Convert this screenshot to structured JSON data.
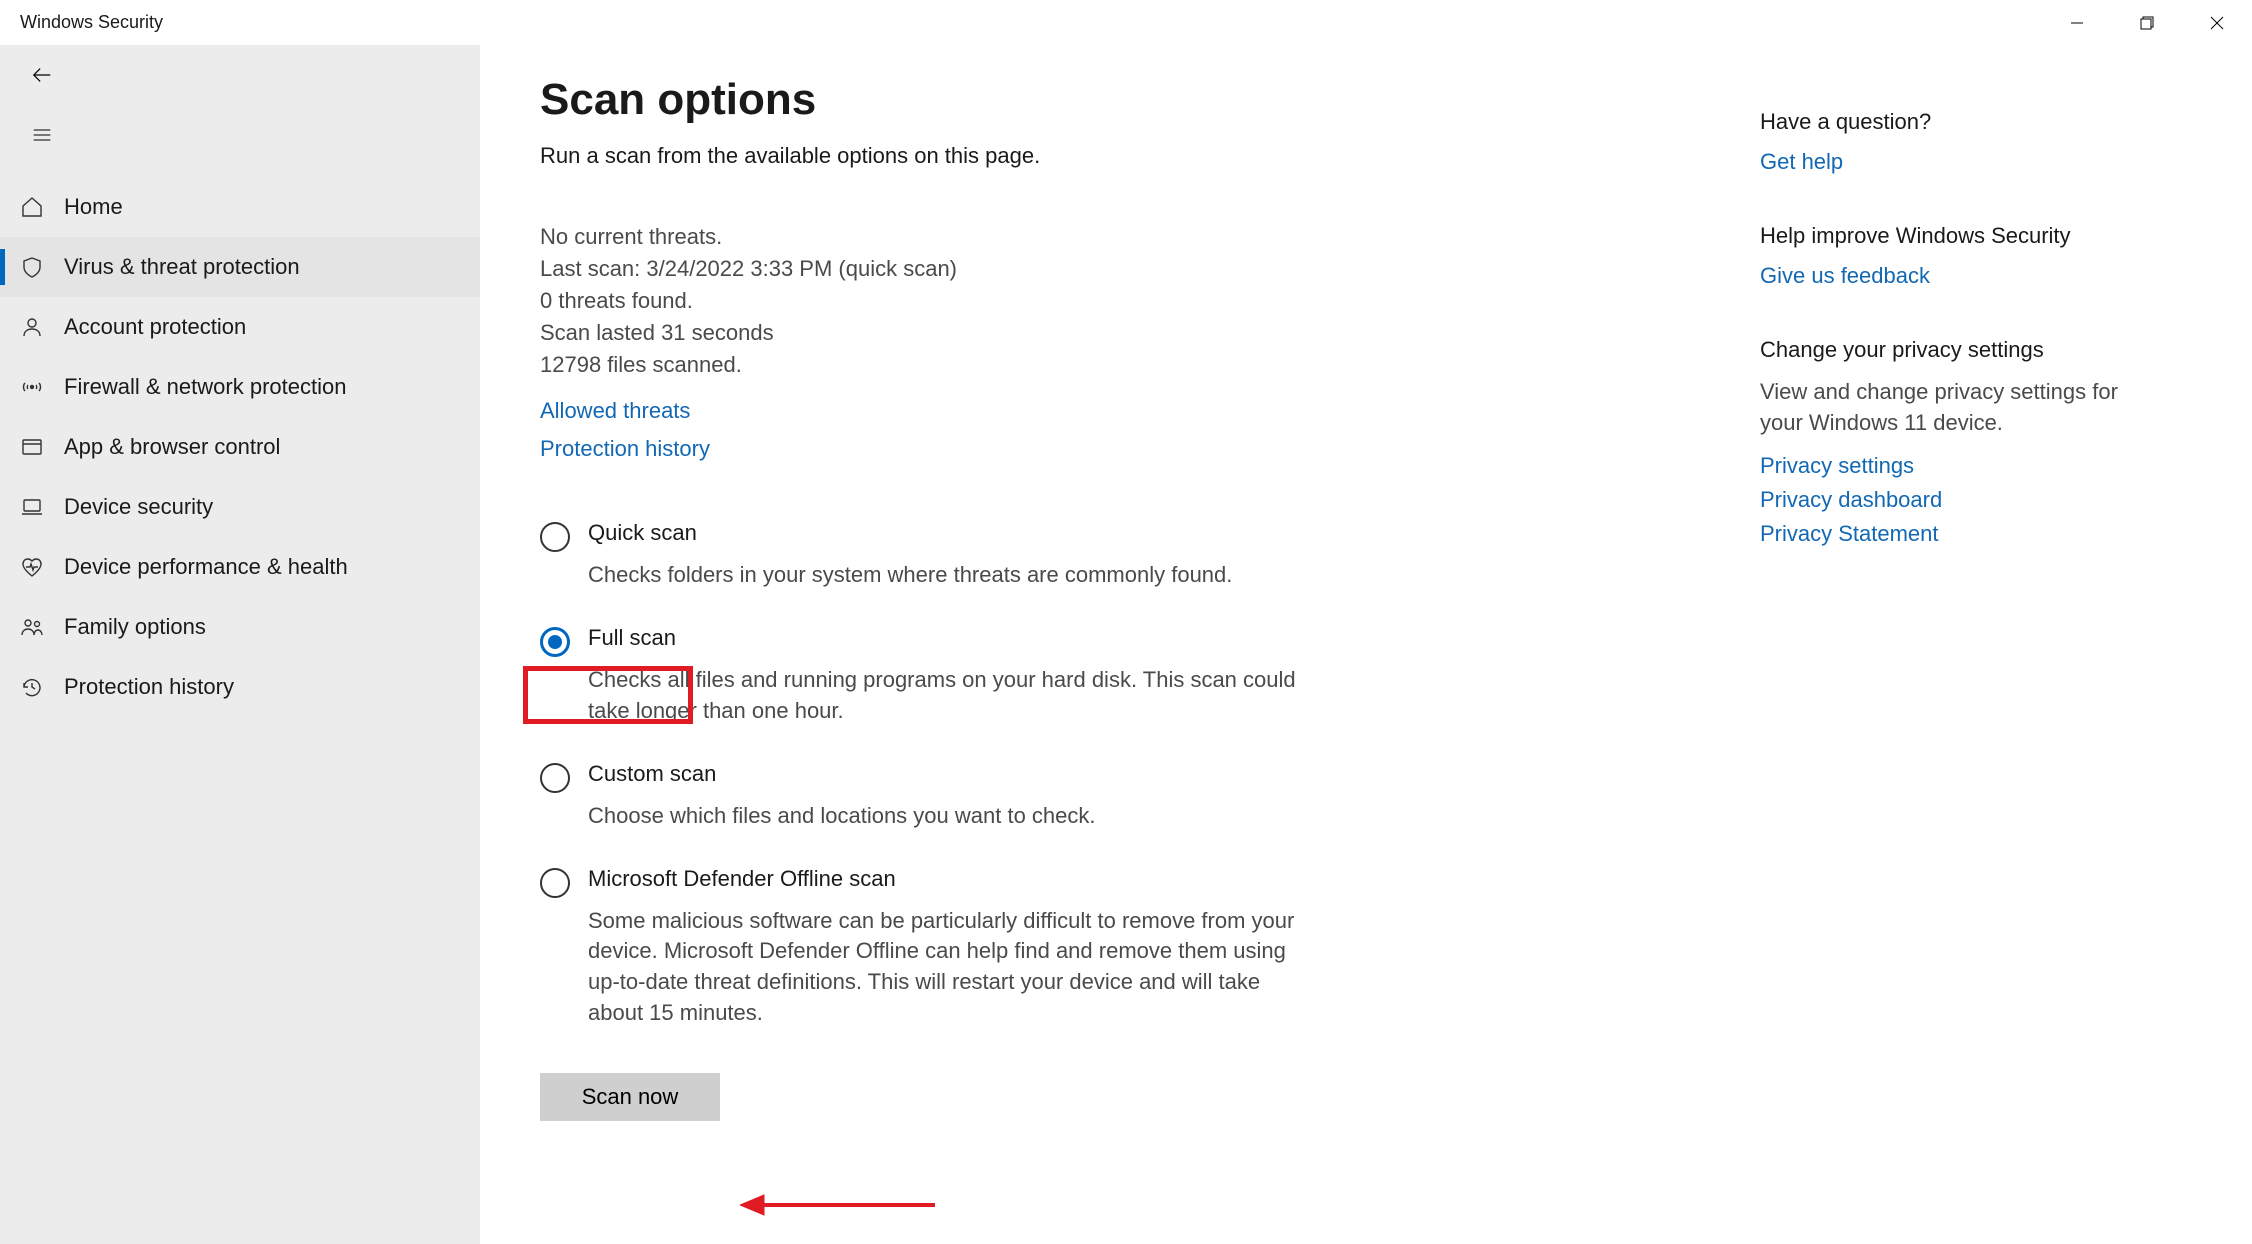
{
  "window": {
    "title": "Windows Security"
  },
  "sidebar": {
    "items": [
      {
        "id": "home",
        "label": "Home"
      },
      {
        "id": "virus",
        "label": "Virus & threat protection"
      },
      {
        "id": "account",
        "label": "Account protection"
      },
      {
        "id": "firewall",
        "label": "Firewall & network protection"
      },
      {
        "id": "app",
        "label": "App & browser control"
      },
      {
        "id": "device",
        "label": "Device security"
      },
      {
        "id": "perf",
        "label": "Device performance & health"
      },
      {
        "id": "family",
        "label": "Family options"
      },
      {
        "id": "history",
        "label": "Protection history"
      }
    ],
    "active_index": 1
  },
  "page": {
    "title": "Scan options",
    "subtitle": "Run a scan from the available options on this page.",
    "status": {
      "line1": "No current threats.",
      "line2": "Last scan: 3/24/2022 3:33 PM (quick scan)",
      "line3": "0 threats found.",
      "line4": "Scan lasted 31 seconds",
      "line5": "12798 files scanned."
    },
    "links": {
      "allowed": "Allowed threats",
      "history": "Protection history"
    },
    "options": [
      {
        "title": "Quick scan",
        "desc": "Checks folders in your system where threats are commonly found.",
        "selected": false
      },
      {
        "title": "Full scan",
        "desc": "Checks all files and running programs on your hard disk. This scan could take longer than one hour.",
        "selected": true
      },
      {
        "title": "Custom scan",
        "desc": "Choose which files and locations you want to check.",
        "selected": false
      },
      {
        "title": "Microsoft Defender Offline scan",
        "desc": "Some malicious software can be particularly difficult to remove from your device. Microsoft Defender Offline can help find and remove them using up-to-date threat definitions. This will restart your device and will take about 15 minutes.",
        "selected": false
      }
    ],
    "scan_button": "Scan now"
  },
  "rail": {
    "sections": [
      {
        "heading": "Have a question?",
        "links": [
          "Get help"
        ]
      },
      {
        "heading": "Help improve Windows Security",
        "links": [
          "Give us feedback"
        ]
      },
      {
        "heading": "Change your privacy settings",
        "text": "View and change privacy settings for your Windows 11 device.",
        "links": [
          "Privacy settings",
          "Privacy dashboard",
          "Privacy Statement"
        ]
      }
    ]
  },
  "annotations": {
    "highlighted_option": "Full scan",
    "arrow_target": "Scan now"
  }
}
